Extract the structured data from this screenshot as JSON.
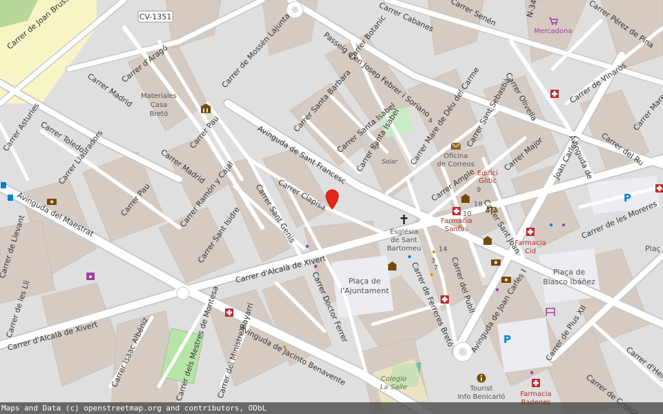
{
  "attribution": "Maps and Data (c) openstreetmap.org and contributors, ODbL",
  "colors": {
    "background": "#e0dfdf",
    "road": "#ffffff",
    "road_casing": "#c9c9c9",
    "building": "#d5cbc3",
    "park": "#c8e6b3",
    "marker": "#e8271b"
  },
  "streets": {
    "joan_brussi": "Carrer de Joan Brussi",
    "cv1351": "CV-1351",
    "mossen_lajunta": "Carrer de Mossèn Lajunta",
    "arago": "Carrer d'Aragó",
    "madrid_1": "Carrer Madrid",
    "asturies": "Carrer Asturies",
    "toledo": "Carrer Toledo",
    "llauradors": "Carrer Llauradors",
    "pau_1": "Carrer Pau",
    "madrid_2": "Carrer Madrid",
    "pau_2": "Carrer Pau",
    "ramon_cajal": "Carrer Ramón y Cajal",
    "maestrat": "Avinguda del Maestrat",
    "llevant": "Carrer de Llevant",
    "les_lli": "Carrer de les Lli",
    "alcala_xivert_1": "Carrer d'Alcalà de Xivert",
    "alcala_xivert_2": "Carrer d'Alcalà de Xivert",
    "isaac_albeniz": "Carrer Isaac Albéniz",
    "mestres_montesa": "Carrer dels Mestres de Montesa",
    "ministre_bayarri": "Carrer del Ministre Bayarri",
    "jacinto_benavente": "Avinguda de Jacinto Benavente",
    "sant_francesc": "Avinguda de Sant Francesc",
    "santa_barbara": "Carrer Santa Barbara",
    "botanic": "Carrer Botanic",
    "josep_febrer": "Passeig d'en Josep Febrer i Soriano",
    "santa_isabel_1": "Carrer Santa Isabel",
    "santa_isabel_2": "Carrer Santa Isabel",
    "clapisa": "Carrer Clapisa",
    "sant_isidre": "Carrer Sant Isidre",
    "sant_genis": "Carrer Sant Genis",
    "doctor_ferrer": "Carrer Doctor Ferrer",
    "cabanes": "Carrer Cabanes",
    "senen": "Carrer Senén",
    "n340": "N-340",
    "perez_pina": "Carrer Pérez de Pina",
    "vinaros": "Carrer de Vinaròs",
    "olivella": "Carrer Olivella",
    "mare_deu_carme": "Carrer Mare de Déu del Carme",
    "sant_sebastia": "Carrer Sant Sebastià",
    "ample": "Carrer Ample",
    "major": "Carrer Major",
    "sant_joan": "Carrer Sant Joan",
    "ferreres_breto": "Carrer de Ferreres Bretó",
    "publl": "Carrer del Publl",
    "joan_carles_1": "Avinguda de Joan Carles I",
    "joan_carles_2": "Joan Carles I",
    "rey_short": "Avinguda de",
    "carrer_ru": "Carrer del Ru",
    "moreres": "Carrer de les Moreres",
    "pius_xii": "Carrer de Pius XII",
    "hernan_cor": "Carrer d'Hernán Co",
    "cristob": "Carrer de Cristób",
    "mare_edge": "Carrer Mare"
  },
  "places": {
    "materiales": [
      "Materiales",
      "Casa",
      "Bretó"
    ],
    "mercadona": "Mercadona",
    "oficina": [
      "Oficina",
      "de Correos"
    ],
    "edifici": [
      "Edifici",
      "Gòtic"
    ],
    "esglesia": [
      "Església",
      "de Sant",
      "Bartomeu"
    ],
    "farmacia_santos": [
      "Farmacia",
      "Santos"
    ],
    "farmacia_cid": [
      "Farmacia",
      "Cid"
    ],
    "farmacia_badenes": [
      "Farmacia",
      "Badenes"
    ],
    "placa_ajuntament": [
      "Plaça de",
      "l'Ajuntament"
    ],
    "placa_blasco": [
      "Plaça de",
      "Blasco Ibáñez"
    ],
    "placa_edge": "Plaç",
    "colegio": [
      "Colegio",
      "La Salle"
    ],
    "tourist": [
      "Tourist",
      "Info Benicarló"
    ],
    "solar": "Solar"
  },
  "house_numbers": {
    "n4": "4",
    "n13": "13",
    "n9": "9",
    "n18": "18",
    "n10": "10",
    "n14": "14",
    "n3": "3",
    "n7": "7"
  },
  "icons": [
    "museum-icon",
    "post-office-icon",
    "church-icon",
    "pharmacy-icon",
    "parking-icon",
    "bus-stop-icon",
    "bank-icon",
    "townhall-icon",
    "supermarket-icon",
    "information-icon",
    "courthouse-icon",
    "marketplace-icon",
    "location-marker-icon"
  ]
}
